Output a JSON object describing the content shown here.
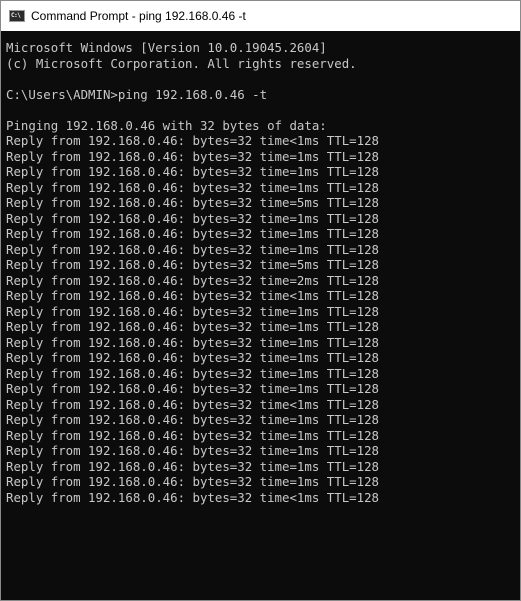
{
  "window": {
    "title": "Command Prompt - ping  192.168.0.46 -t",
    "icon_label": "C:\\"
  },
  "console": {
    "header_version": "Microsoft Windows [Version 10.0.19045.2604]",
    "header_copyright": "(c) Microsoft Corporation. All rights reserved.",
    "command_line": "C:\\Users\\ADMIN>ping 192.168.0.46 -t",
    "pinging_line": "Pinging 192.168.0.46 with 32 bytes of data:",
    "replies": [
      "Reply from 192.168.0.46: bytes=32 time<1ms TTL=128",
      "Reply from 192.168.0.46: bytes=32 time=1ms TTL=128",
      "Reply from 192.168.0.46: bytes=32 time=1ms TTL=128",
      "Reply from 192.168.0.46: bytes=32 time=1ms TTL=128",
      "Reply from 192.168.0.46: bytes=32 time=5ms TTL=128",
      "Reply from 192.168.0.46: bytes=32 time=1ms TTL=128",
      "Reply from 192.168.0.46: bytes=32 time=1ms TTL=128",
      "Reply from 192.168.0.46: bytes=32 time=1ms TTL=128",
      "Reply from 192.168.0.46: bytes=32 time=5ms TTL=128",
      "Reply from 192.168.0.46: bytes=32 time=2ms TTL=128",
      "Reply from 192.168.0.46: bytes=32 time<1ms TTL=128",
      "Reply from 192.168.0.46: bytes=32 time=1ms TTL=128",
      "Reply from 192.168.0.46: bytes=32 time=1ms TTL=128",
      "Reply from 192.168.0.46: bytes=32 time=1ms TTL=128",
      "Reply from 192.168.0.46: bytes=32 time=1ms TTL=128",
      "Reply from 192.168.0.46: bytes=32 time=1ms TTL=128",
      "Reply from 192.168.0.46: bytes=32 time=1ms TTL=128",
      "Reply from 192.168.0.46: bytes=32 time<1ms TTL=128",
      "Reply from 192.168.0.46: bytes=32 time=1ms TTL=128",
      "Reply from 192.168.0.46: bytes=32 time=1ms TTL=128",
      "Reply from 192.168.0.46: bytes=32 time=1ms TTL=128",
      "Reply from 192.168.0.46: bytes=32 time=1ms TTL=128",
      "Reply from 192.168.0.46: bytes=32 time=1ms TTL=128",
      "Reply from 192.168.0.46: bytes=32 time<1ms TTL=128"
    ]
  },
  "colors": {
    "console_background": "#0c0c0c",
    "console_text": "#c8c8c8",
    "titlebar_background": "#ffffff"
  }
}
